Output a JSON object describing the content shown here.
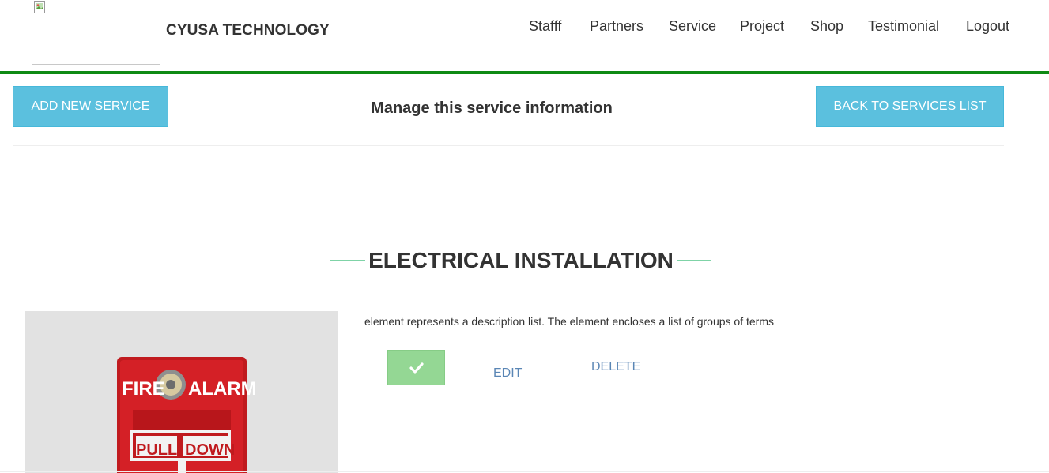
{
  "header": {
    "brand": "CYUSA TECHNOLOGY",
    "logo_alt": "",
    "nav": [
      "Stafff",
      "Partners",
      "Service",
      "Project",
      "Shop",
      "Testimonial",
      "Logout"
    ]
  },
  "toolbar": {
    "add_label": "ADD NEW SERVICE",
    "title": "Manage this service information",
    "back_label": "BACK TO SERVICES LIST"
  },
  "service": {
    "title": "ELECTRICAL INSTALLATION",
    "description": "element represents a description list. The element encloses a list of groups of terms",
    "image_text": {
      "line1_left": "FIRE",
      "line1_right": "ALARM",
      "line2_left": "PULL",
      "line2_right": "DOWN"
    },
    "actions": {
      "approve_icon": "check-icon",
      "edit_label": "EDIT",
      "delete_label": "DELETE"
    }
  },
  "colors": {
    "accent_green": "#0e8a14",
    "button_blue": "#5bc0de",
    "approve_green": "#94d794",
    "link_blue": "#5a86b5"
  }
}
